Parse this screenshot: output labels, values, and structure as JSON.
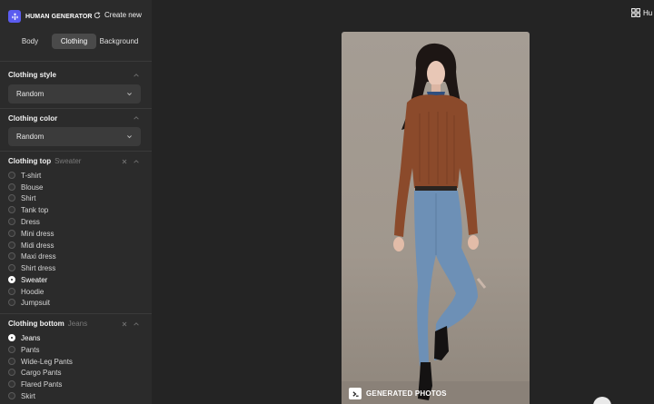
{
  "app": {
    "brand": "HUMAN GENERATOR",
    "create_new": "Create new",
    "top_right_label": "Hu"
  },
  "tabs": [
    {
      "label": "Body",
      "active": false
    },
    {
      "label": "Clothing",
      "active": true
    },
    {
      "label": "Background",
      "active": false
    }
  ],
  "clothing_style": {
    "title": "Clothing style",
    "value": "Random"
  },
  "clothing_color": {
    "title": "Clothing color",
    "value": "Random"
  },
  "clothing_top": {
    "title": "Clothing top",
    "selected": "Sweater",
    "options": [
      "T-shirt",
      "Blouse",
      "Shirt",
      "Tank top",
      "Dress",
      "Mini dress",
      "Midi dress",
      "Maxi dress",
      "Shirt dress",
      "Sweater",
      "Hoodie",
      "Jumpsuit"
    ]
  },
  "clothing_bottom": {
    "title": "Clothing bottom",
    "selected": "Jeans",
    "options": [
      "Jeans",
      "Pants",
      "Wide-Leg Pants",
      "Cargo Pants",
      "Flared Pants",
      "Skirt"
    ]
  },
  "preview": {
    "watermark": "GENERATED PHOTOS"
  },
  "colors": {
    "accent": "#5b5cf0",
    "sidebar_bg": "#2b2b2b",
    "main_bg": "#242424",
    "select_bg": "#3b3b3b"
  },
  "icons": [
    "logo-icon",
    "refresh-icon",
    "chevron-up-icon",
    "chevron-down-icon",
    "close-icon",
    "grid-icon",
    "terminal-icon",
    "chat-icon"
  ]
}
